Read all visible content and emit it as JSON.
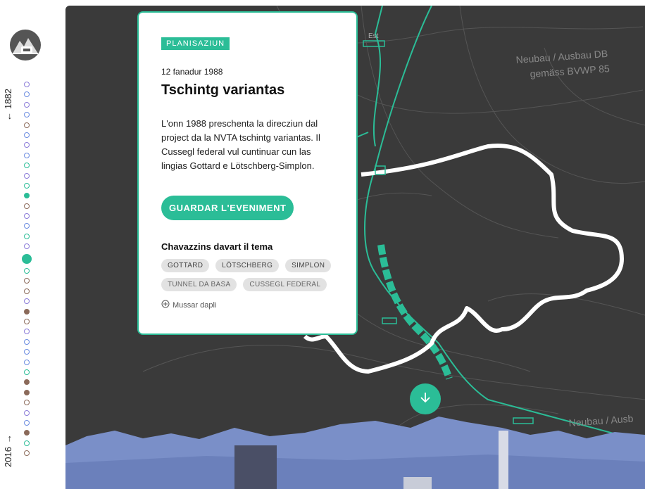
{
  "rail": {
    "year_top": "1882",
    "year_bottom": "2016",
    "dots": [
      "#8a7bd8",
      "#6a8be0",
      "#8a7bd8",
      "#6a8be0",
      "#8b6a5a",
      "#6a8be0",
      "#8a7bd8",
      "#6a8be0",
      "#2bbd97",
      "#8a7bd8",
      "#2bbd97",
      "#2bbd97f",
      "#8b6a5a",
      "#8a7bd8",
      "#6a8be0",
      "#2bbd97",
      "#8a7bd8",
      "#2bbd97BIG",
      "#2bbd97",
      "#8b6a5a",
      "#8b6a5a",
      "#8a7bd8",
      "#8b6a5af",
      "#8b6a5a",
      "#8a7bd8",
      "#6a8be0",
      "#6a8be0",
      "#6a8be0",
      "#2bbd97",
      "#8b6a5af",
      "#8b6a5af",
      "#8b6a5a",
      "#8a7bd8",
      "#6a8be0",
      "#8b6a5af",
      "#2bbd97",
      "#8b6a5a"
    ]
  },
  "card": {
    "category": "PLANISAZIUN",
    "date": "12 fanadur 1988",
    "title": "Tschintg variantas",
    "description": "L'onn 1988 preschenta la direcziun dal project da la NVTA tschintg variantas. Il Cussegl federal vul cuntinuar cun las lingias Gottard e Lötschberg-Simplon.",
    "cta": "GUARDAR L'EVENIMENT",
    "tags_title": "Chavazzins davart il tema",
    "tags": [
      "GOTTARD",
      "LÖTSCHBERG",
      "SIMPLON",
      "TUNNEL DA BASA",
      "CUSSEGL FEDERAL"
    ],
    "more": "Mussar dapli"
  },
  "map": {
    "labels": [
      "Est",
      "Neubau / Ausbau DB",
      "gemäss BVWP 85",
      "Neubau / Ausb"
    ]
  },
  "colors": {
    "accent": "#2bbd97",
    "map_bg": "#3a3a3a"
  }
}
